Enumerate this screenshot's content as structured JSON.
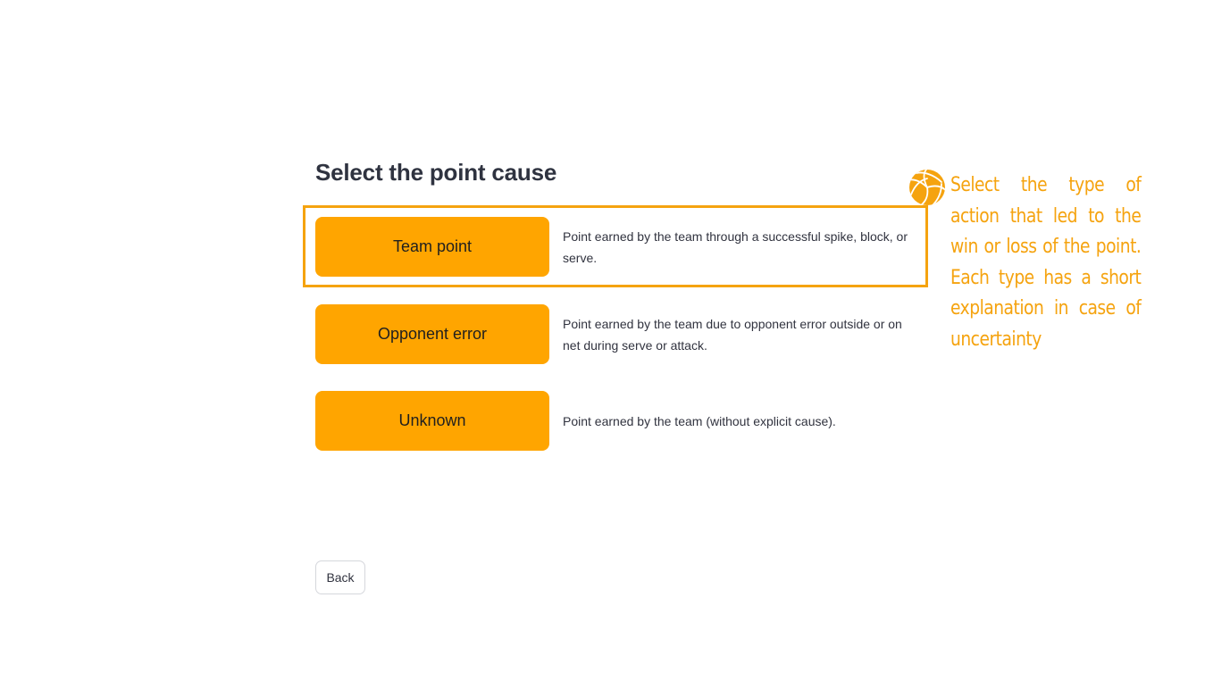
{
  "page": {
    "title": "Select the point cause"
  },
  "options": [
    {
      "label": "Team point",
      "description": "Point earned by the team through a successful spike, block, or serve."
    },
    {
      "label": "Opponent error",
      "description": "Point earned by the team due to opponent error outside or on net during serve or attack."
    },
    {
      "label": "Unknown",
      "description": "Point earned by the team (without explicit cause)."
    }
  ],
  "footer": {
    "back_label": "Back"
  },
  "tip": {
    "icon": "volleyball-icon",
    "text": "Select the type of action that led to the win or loss of the point. Each type has a short explanation in case of uncertainty"
  },
  "colors": {
    "accent": "#ffa500",
    "annotation": "#f5a30f",
    "text": "#31333f",
    "title": "#2f3340"
  }
}
